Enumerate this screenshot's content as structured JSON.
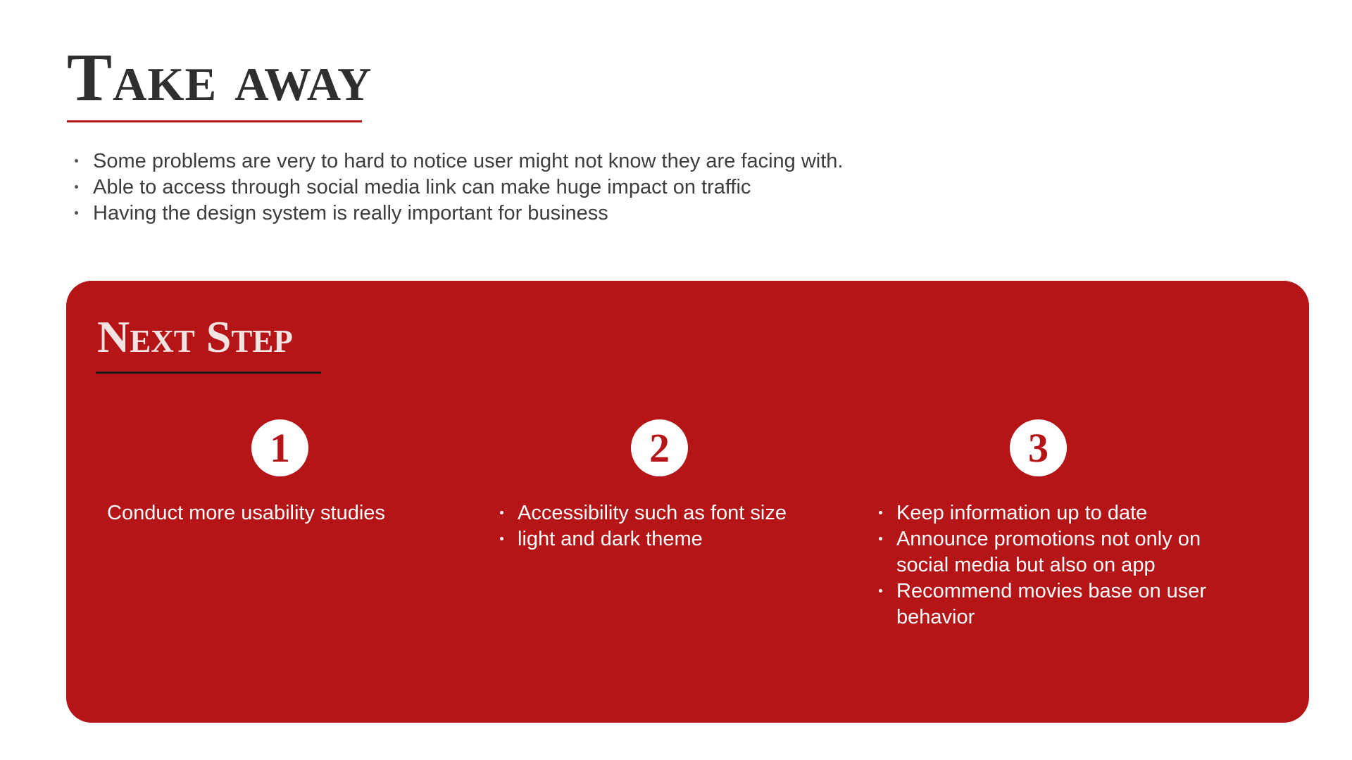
{
  "takeaway": {
    "title": "Take away",
    "items": [
      "Some problems are very to hard to notice user might not know they are facing with.",
      "Able to access through social media link can make huge impact on traffic",
      "Having the design system is really important for business"
    ]
  },
  "next_step": {
    "title": "Next Step",
    "steps": [
      {
        "number": "1",
        "text": "Conduct more usability studies"
      },
      {
        "number": "2",
        "items": [
          "Accessibility such as font size",
          "light and dark theme"
        ]
      },
      {
        "number": "3",
        "items": [
          "Keep information up to date",
          "Announce promotions not only on social media but also on app",
          "Recommend movies base on user behavior"
        ]
      }
    ]
  },
  "colors": {
    "accent_red": "#b51517",
    "title_dark": "#2f2f2f",
    "body_text": "#3d3d3d",
    "panel_text": "#ffffff"
  }
}
